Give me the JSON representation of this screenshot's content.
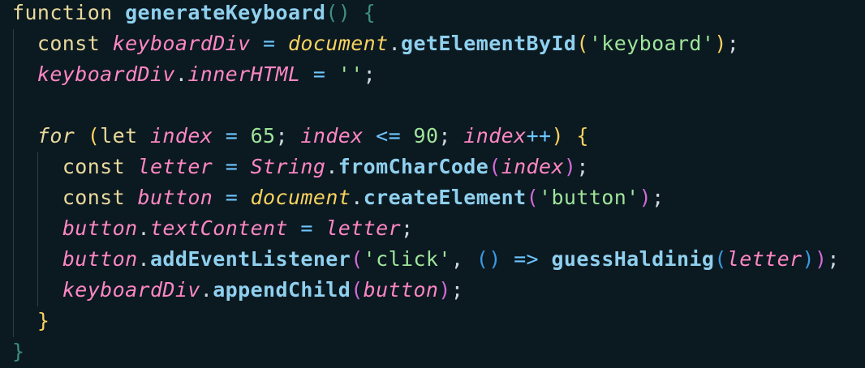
{
  "code": {
    "language": "javascript",
    "lines": [
      [
        {
          "t": "function",
          "c": "kw"
        },
        {
          "t": " ",
          "c": "pl"
        },
        {
          "t": "generateKeyboard",
          "c": "fn"
        },
        {
          "t": "()",
          "c": "brg"
        },
        {
          "t": " ",
          "c": "pl"
        },
        {
          "t": "{",
          "c": "brg"
        }
      ],
      [
        {
          "t": "  ",
          "c": "pl"
        },
        {
          "t": "const",
          "c": "kw"
        },
        {
          "t": " ",
          "c": "pl"
        },
        {
          "t": "keyboardDiv",
          "c": "vi"
        },
        {
          "t": " ",
          "c": "pl"
        },
        {
          "t": "=",
          "c": "op"
        },
        {
          "t": " ",
          "c": "pl"
        },
        {
          "t": "document",
          "c": "obj"
        },
        {
          "t": ".",
          "c": "pl"
        },
        {
          "t": "getElementById",
          "c": "fn"
        },
        {
          "t": "(",
          "c": "br1"
        },
        {
          "t": "'keyboard'",
          "c": "str"
        },
        {
          "t": ")",
          "c": "br1"
        },
        {
          "t": ";",
          "c": "pl"
        }
      ],
      [
        {
          "t": "  ",
          "c": "pl"
        },
        {
          "t": "keyboardDiv",
          "c": "vi"
        },
        {
          "t": ".",
          "c": "pl"
        },
        {
          "t": "innerHTML",
          "c": "vi"
        },
        {
          "t": " ",
          "c": "pl"
        },
        {
          "t": "=",
          "c": "op"
        },
        {
          "t": " ",
          "c": "pl"
        },
        {
          "t": "''",
          "c": "str"
        },
        {
          "t": ";",
          "c": "pl"
        }
      ],
      [],
      [
        {
          "t": "  ",
          "c": "pl"
        },
        {
          "t": "for",
          "c": "kwi"
        },
        {
          "t": " ",
          "c": "pl"
        },
        {
          "t": "(",
          "c": "br1"
        },
        {
          "t": "let",
          "c": "kw"
        },
        {
          "t": " ",
          "c": "pl"
        },
        {
          "t": "index",
          "c": "vi"
        },
        {
          "t": " ",
          "c": "pl"
        },
        {
          "t": "=",
          "c": "op"
        },
        {
          "t": " ",
          "c": "pl"
        },
        {
          "t": "65",
          "c": "num"
        },
        {
          "t": "; ",
          "c": "pl"
        },
        {
          "t": "index",
          "c": "vi"
        },
        {
          "t": " ",
          "c": "pl"
        },
        {
          "t": "<=",
          "c": "op"
        },
        {
          "t": " ",
          "c": "pl"
        },
        {
          "t": "90",
          "c": "num"
        },
        {
          "t": "; ",
          "c": "pl"
        },
        {
          "t": "index",
          "c": "vi"
        },
        {
          "t": "++",
          "c": "op"
        },
        {
          "t": ")",
          "c": "br1"
        },
        {
          "t": " ",
          "c": "pl"
        },
        {
          "t": "{",
          "c": "br1"
        }
      ],
      [
        {
          "t": "    ",
          "c": "pl"
        },
        {
          "t": "const",
          "c": "kw"
        },
        {
          "t": " ",
          "c": "pl"
        },
        {
          "t": "letter",
          "c": "vi"
        },
        {
          "t": " ",
          "c": "pl"
        },
        {
          "t": "=",
          "c": "op"
        },
        {
          "t": " ",
          "c": "pl"
        },
        {
          "t": "String",
          "c": "cls"
        },
        {
          "t": ".",
          "c": "pl"
        },
        {
          "t": "fromCharCode",
          "c": "fn"
        },
        {
          "t": "(",
          "c": "br2"
        },
        {
          "t": "index",
          "c": "vi"
        },
        {
          "t": ")",
          "c": "br2"
        },
        {
          "t": ";",
          "c": "pl"
        }
      ],
      [
        {
          "t": "    ",
          "c": "pl"
        },
        {
          "t": "const",
          "c": "kw"
        },
        {
          "t": " ",
          "c": "pl"
        },
        {
          "t": "button",
          "c": "vi"
        },
        {
          "t": " ",
          "c": "pl"
        },
        {
          "t": "=",
          "c": "op"
        },
        {
          "t": " ",
          "c": "pl"
        },
        {
          "t": "document",
          "c": "obj"
        },
        {
          "t": ".",
          "c": "pl"
        },
        {
          "t": "createElement",
          "c": "fn"
        },
        {
          "t": "(",
          "c": "br2"
        },
        {
          "t": "'button'",
          "c": "str"
        },
        {
          "t": ")",
          "c": "br2"
        },
        {
          "t": ";",
          "c": "pl"
        }
      ],
      [
        {
          "t": "    ",
          "c": "pl"
        },
        {
          "t": "button",
          "c": "vi"
        },
        {
          "t": ".",
          "c": "pl"
        },
        {
          "t": "textContent",
          "c": "vi"
        },
        {
          "t": " ",
          "c": "pl"
        },
        {
          "t": "=",
          "c": "op"
        },
        {
          "t": " ",
          "c": "pl"
        },
        {
          "t": "letter",
          "c": "vi"
        },
        {
          "t": ";",
          "c": "pl"
        }
      ],
      [
        {
          "t": "    ",
          "c": "pl"
        },
        {
          "t": "button",
          "c": "vi"
        },
        {
          "t": ".",
          "c": "pl"
        },
        {
          "t": "addEventListener",
          "c": "fn"
        },
        {
          "t": "(",
          "c": "br2"
        },
        {
          "t": "'click'",
          "c": "str"
        },
        {
          "t": ", ",
          "c": "pl"
        },
        {
          "t": "()",
          "c": "br3"
        },
        {
          "t": " ",
          "c": "pl"
        },
        {
          "t": "=>",
          "c": "op"
        },
        {
          "t": " ",
          "c": "pl"
        },
        {
          "t": "guessHaldinig",
          "c": "fn"
        },
        {
          "t": "(",
          "c": "br3"
        },
        {
          "t": "letter",
          "c": "vi"
        },
        {
          "t": ")",
          "c": "br3"
        },
        {
          "t": ")",
          "c": "br2"
        },
        {
          "t": ";",
          "c": "pl"
        }
      ],
      [
        {
          "t": "    ",
          "c": "pl"
        },
        {
          "t": "keyboardDiv",
          "c": "vi"
        },
        {
          "t": ".",
          "c": "pl"
        },
        {
          "t": "appendChild",
          "c": "fn"
        },
        {
          "t": "(",
          "c": "br2"
        },
        {
          "t": "button",
          "c": "vi"
        },
        {
          "t": ")",
          "c": "br2"
        },
        {
          "t": ";",
          "c": "pl"
        }
      ],
      [
        {
          "t": "  ",
          "c": "pl"
        },
        {
          "t": "}",
          "c": "br1"
        }
      ],
      [
        {
          "t": "}",
          "c": "brg"
        }
      ]
    ]
  }
}
